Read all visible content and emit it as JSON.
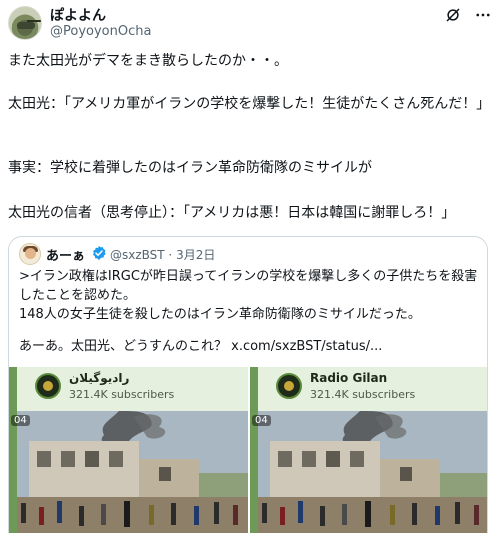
{
  "tweet": {
    "author_name": "ぽよよん",
    "author_handle": "@PoyoyonOcha",
    "lines": [
      "また太田光がデマをまき散らしたのか・・。",
      "太田光：「アメリカ軍がイランの学校を爆撃した！生徒がたくさん死んだ！」",
      "事実：学校に着弾したのはイラン革命防衛隊のミサイルが",
      "太田光の信者（思考停止）：「アメリカは悪！日本は韓国に謝罪しろ！」"
    ]
  },
  "quote": {
    "author_name": "あーぁ",
    "author_handle": "@sxzBST · 3月2日",
    "lines": [
      ">イラン政権はIRGCが昨日誤ってイランの学校を爆撃し多くの子供たちを殺害",
      "したことを認めた。",
      "148人の女子生徒を殺したのはイラン革命防衛隊のミサイルだった。",
      "あーあ。太田光、どうすんのこれ？ x.com/sxzBST/status/..."
    ],
    "media": [
      {
        "channel": "رادیوگیلان",
        "subscribers": "321.4K subscribers",
        "time": "04"
      },
      {
        "channel": "Radio Gilan",
        "subscribers": "321.4K subscribers",
        "time": "04"
      }
    ]
  },
  "colors": {
    "text": "#0f1419",
    "secondary": "#536471",
    "border": "#cfd9de",
    "verified": "#1d9bf0",
    "telegram_bg": "#e6f0df"
  },
  "icons": [
    "grok-icon",
    "more-icon",
    "verified-icon"
  ]
}
